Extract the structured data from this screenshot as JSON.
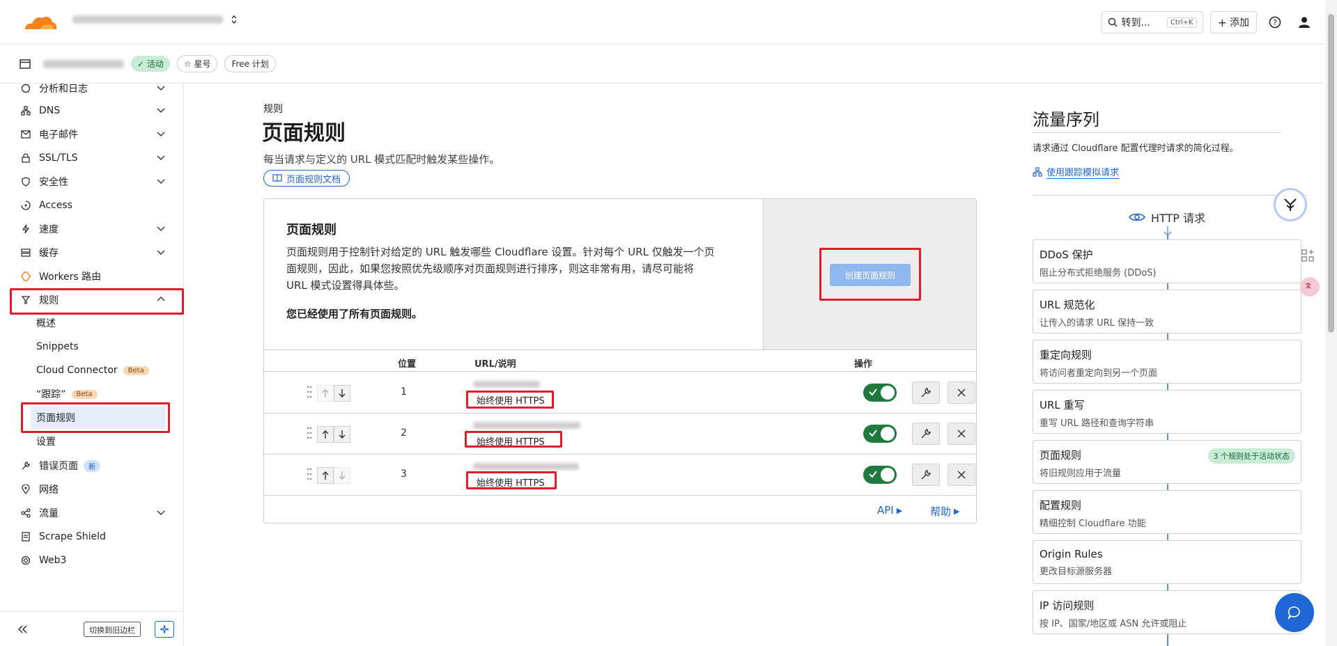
{
  "header": {
    "goto_label": "转到...",
    "goto_shortcut": "Ctrl+K",
    "add_label": "添加"
  },
  "zone": {
    "status": "活动",
    "star_label": "星号",
    "plan_label": "Free 计划"
  },
  "sidebar": {
    "items": [
      {
        "label": "分析和日志"
      },
      {
        "label": "DNS"
      },
      {
        "label": "电子邮件"
      },
      {
        "label": "SSL/TLS"
      },
      {
        "label": "安全性"
      },
      {
        "label": "Access"
      },
      {
        "label": "速度"
      },
      {
        "label": "缓存"
      },
      {
        "label": "Workers 路由"
      },
      {
        "label": "规则"
      },
      {
        "label": "错误页面"
      },
      {
        "label": "网络"
      },
      {
        "label": "流量"
      },
      {
        "label": "Scrape Shield"
      },
      {
        "label": "Web3"
      }
    ],
    "rules_sub": [
      {
        "label": "概述"
      },
      {
        "label": "Snippets"
      },
      {
        "label": "Cloud Connector"
      },
      {
        "label": "“跟踪”"
      },
      {
        "label": "页面规则"
      },
      {
        "label": "设置"
      }
    ],
    "beta_label": "Beta",
    "new_label": "新",
    "switch_label": "切换到旧边栏"
  },
  "main": {
    "breadcrumb": "规则",
    "title": "页面规则",
    "description": "每当请求与定义的 URL 模式匹配时触发某些操作。",
    "doc_button": "页面规则文档",
    "panel": {
      "heading": "页面规则",
      "body_line1": "页面规则用于控制针对给定的 URL 触发哪些 Cloudflare 设置。针对每个 URL 仅触发一个页",
      "body_line2": "面规则，因此，如果您按照优先级顺序对页面规则进行排序，则这非常有用，请尽可能将",
      "body_line3": "URL 模式设置得具体些。",
      "notice": "您已经使用了所有页面规则。",
      "create_button": "创建页面规则"
    },
    "table": {
      "col_position": "位置",
      "col_url": "URL/说明",
      "col_actions": "操作",
      "rows": [
        {
          "position": "1",
          "description": "始终使用 HTTPS"
        },
        {
          "position": "2",
          "description": "始终使用 HTTPS"
        },
        {
          "position": "3",
          "description": "始终使用 HTTPS"
        }
      ]
    },
    "footer": {
      "api_label": "API",
      "help_label": "帮助"
    }
  },
  "traffic": {
    "title": "流量序列",
    "description": "请求通过 Cloudflare 配置代理时请求的简化过程。",
    "trace_link": "使用跟踪模拟请求",
    "http_label": "HTTP 请求",
    "cards": [
      {
        "title": "DDoS 保护",
        "subtitle": "阻止分布式拒绝服务 (DDoS)"
      },
      {
        "title": "URL 规范化",
        "subtitle": "让传入的请求 URL 保持一致"
      },
      {
        "title": "重定向规则",
        "subtitle": "将访问者重定向到另一个页面"
      },
      {
        "title": "URL 重写",
        "subtitle": "重写 URL 路径和查询字符串"
      },
      {
        "title": "页面规则",
        "subtitle": "将旧规则应用于流量",
        "badge": "3 个规则处于活动状态"
      },
      {
        "title": "配置规则",
        "subtitle": "精细控制 Cloudflare 功能"
      },
      {
        "title": "Origin Rules",
        "subtitle": "更改目标源服务器"
      },
      {
        "title": "IP 访问规则",
        "subtitle": "按 IP、国家/地区或 ASN 允许或阻止"
      }
    ]
  },
  "colors": {
    "accent": "#1f67d6",
    "highlight": "#e21b2b",
    "toggle_on": "#1e7a3c",
    "brand_orange": "#f6821f"
  }
}
